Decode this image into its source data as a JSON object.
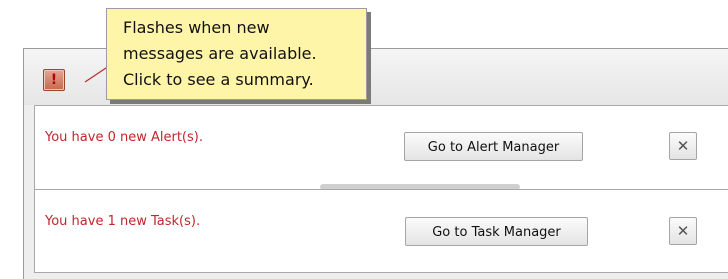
{
  "callout": {
    "lines": [
      "Flashes when new",
      "messages are available.",
      "Click to see a summary."
    ]
  },
  "toolbar": {
    "alert_icon_glyph": "!",
    "alert_icon_name": "exclamation-icon"
  },
  "alerts": {
    "message": "You have 0 new Alert(s).",
    "button_label": "Go to Alert Manager",
    "close_glyph": "✕"
  },
  "tasks": {
    "message": "You have 1 new Task(s).",
    "button_label": "Go to Task Manager",
    "close_glyph": "✕"
  },
  "colors": {
    "message_text": "#c1272d",
    "callout_bg": "#fff5a8",
    "icon_accent": "#c8684e"
  }
}
